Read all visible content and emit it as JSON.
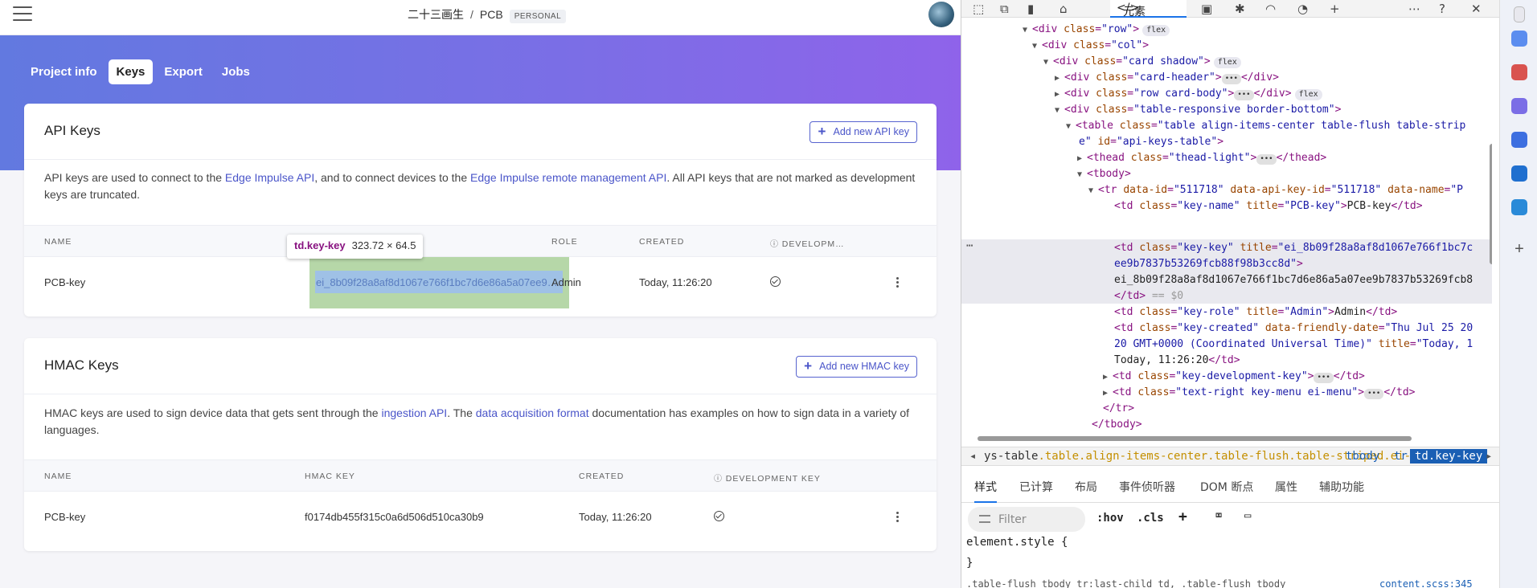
{
  "header": {
    "project_owner": "二十三画生",
    "separator": "/",
    "project_name": "PCB",
    "badge": "PERSONAL"
  },
  "tabs": [
    "Project info",
    "Keys",
    "Export",
    "Jobs"
  ],
  "active_tab": "Keys",
  "api_keys": {
    "title": "API Keys",
    "add_button": "Add new API key",
    "desc_1": "API keys are used to connect to the ",
    "link_1": "Edge Impulse API",
    "desc_2": ", and to connect devices to the ",
    "link_2": "Edge Impulse remote management API",
    "desc_3": ". All API keys that are not marked as development keys are truncated.",
    "columns": {
      "name": "NAME",
      "role": "ROLE",
      "created": "CREATED",
      "dev": "DEVELOPM…"
    },
    "rows": [
      {
        "name": "PCB-key",
        "key": "ei_8b09f28a8af8d1067e766f1bc7d6e86a5a07ee9…",
        "role": "Admin",
        "created": "Today, 11:26:20"
      }
    ]
  },
  "tooltip": {
    "selector": "td.key-key",
    "size": "323.72 × 64.5"
  },
  "hmac_keys": {
    "title": "HMAC Keys",
    "add_button": "Add new HMAC key",
    "desc_1": "HMAC keys are used to sign device data that gets sent through the ",
    "link_1": "ingestion API",
    "desc_2": ". The ",
    "link_2": "data acquisition format",
    "desc_3": " documentation has examples on how to sign data in a variety of languages.",
    "columns": {
      "name": "NAME",
      "key": "HMAC KEY",
      "created": "CREATED",
      "dev": "DEVELOPMENT KEY"
    },
    "rows": [
      {
        "name": "PCB-key",
        "key": "f0174db455f315c0a6d506d510ca30b9",
        "created": "Today, 11:26:20"
      }
    ]
  },
  "devtools": {
    "elements_tab": "元素",
    "breadcrumb_prefix": "ys-table",
    "breadcrumb_classes": ".table.align-items-center.table-flush.table-striped.ei-table",
    "breadcrumb_tbody": "tbody",
    "breadcrumb_tr": "tr",
    "breadcrumb_selected": "td.key-key",
    "styles_tabs": [
      "样式",
      "已计算",
      "布局",
      "事件侦听器",
      "DOM 断点",
      "属性",
      "辅助功能"
    ],
    "filter_placeholder": "Filter",
    "hov": ":hov",
    "cls": ".cls",
    "element_style": "element.style {",
    "close_brace": "}",
    "last_line": ".table-flush tbody tr:last-child td, .table-flush tbody",
    "last_link": "content.scss:345"
  }
}
